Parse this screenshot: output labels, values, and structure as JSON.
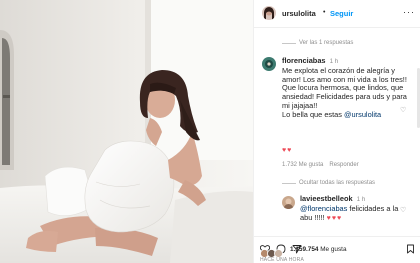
{
  "post": {
    "author": "ursulolita",
    "separator": "•",
    "follow_label": "Seguir",
    "more_label": "···"
  },
  "comments": {
    "view_replies_top": "Ver las 1 respuestas",
    "main": {
      "username": "florenciabas",
      "time": "1 h",
      "text": "Me explota el corazón de alegría y amor! Los amo con mi vida a los tres!! Que locura hermosa, que lindos, que ansiedad! Felicidades para uds y para mi jajajaa!!",
      "line2_prefix": "Lo bella que estas ",
      "line2_mention": "@ursulolita",
      "hearts": "♥♥",
      "likes": "1.732 Me gusta",
      "reply_label": "Responder"
    },
    "hide_replies": "Ocultar todas las respuestas",
    "reply": {
      "username": "lavieestbelleok",
      "time": "1 h",
      "mention": "@florenciabas",
      "text": " felicidades a la abu !!!!!",
      "hearts": "♥♥♥"
    }
  },
  "footer": {
    "likes_count": "1.159.754",
    "likes_label": " Me gusta",
    "date": "HACE UNA HORA"
  },
  "icons": {
    "heart": "heart-icon",
    "comment": "comment-icon",
    "share": "share-icon",
    "save": "bookmark-icon",
    "more": "more-options-icon"
  },
  "colors": {
    "follow": "#0095f6",
    "heart": "#ed4956",
    "text": "#262626",
    "muted": "#8e8e8e"
  }
}
